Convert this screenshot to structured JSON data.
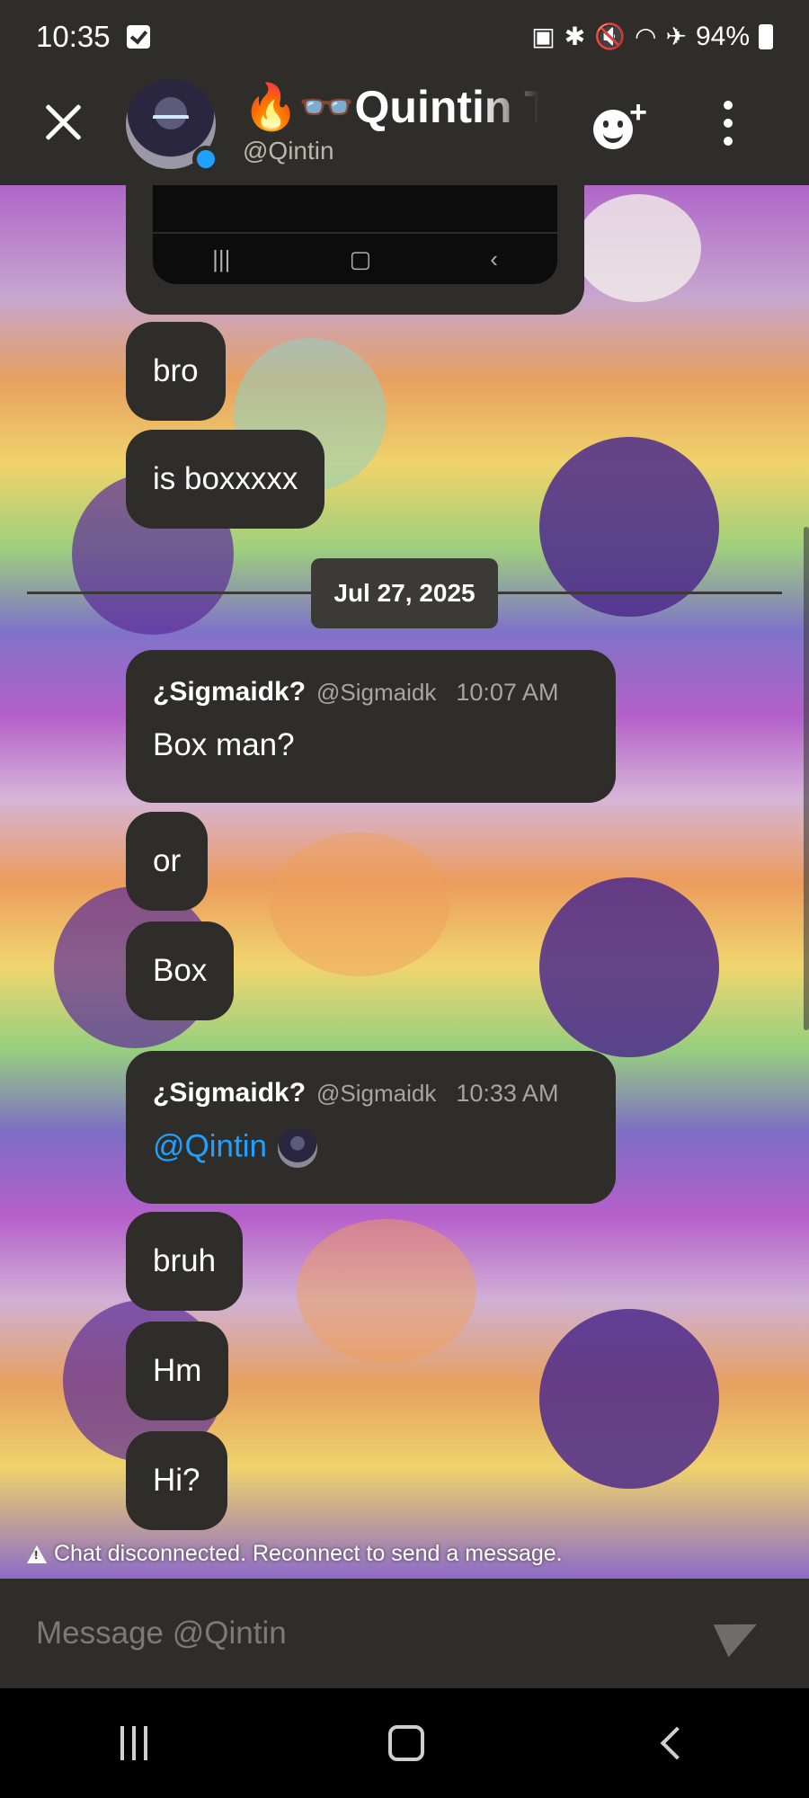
{
  "status_bar": {
    "time": "10:35",
    "battery": "94%"
  },
  "header": {
    "title": "🔥👓Quintin T",
    "handle": "@Qintin"
  },
  "phone_nav_glyphs": [
    "|||",
    "▢",
    "‹"
  ],
  "messages": [
    {
      "text": "bro"
    },
    {
      "text": "is boxxxxx"
    }
  ],
  "date_divider": "Jul 27, 2025",
  "groups": [
    {
      "author": "¿Sigmaidk?",
      "handle": "@Sigmaidk",
      "time": "10:07 AM",
      "first": "Box man?",
      "followups": [
        "or",
        "Box"
      ]
    },
    {
      "author": "¿Sigmaidk?",
      "handle": "@Sigmaidk",
      "time": "10:33 AM",
      "mention": "@Qintin",
      "followups": [
        "bruh",
        "Hm",
        "Hi?"
      ]
    }
  ],
  "notice": "Chat disconnected. Reconnect to send a message.",
  "composer": {
    "placeholder": "Message @Qintin"
  },
  "colors": {
    "bubble": "#2f2d2a",
    "accent": "#1fa1ff",
    "online": "#1fa1ff"
  }
}
